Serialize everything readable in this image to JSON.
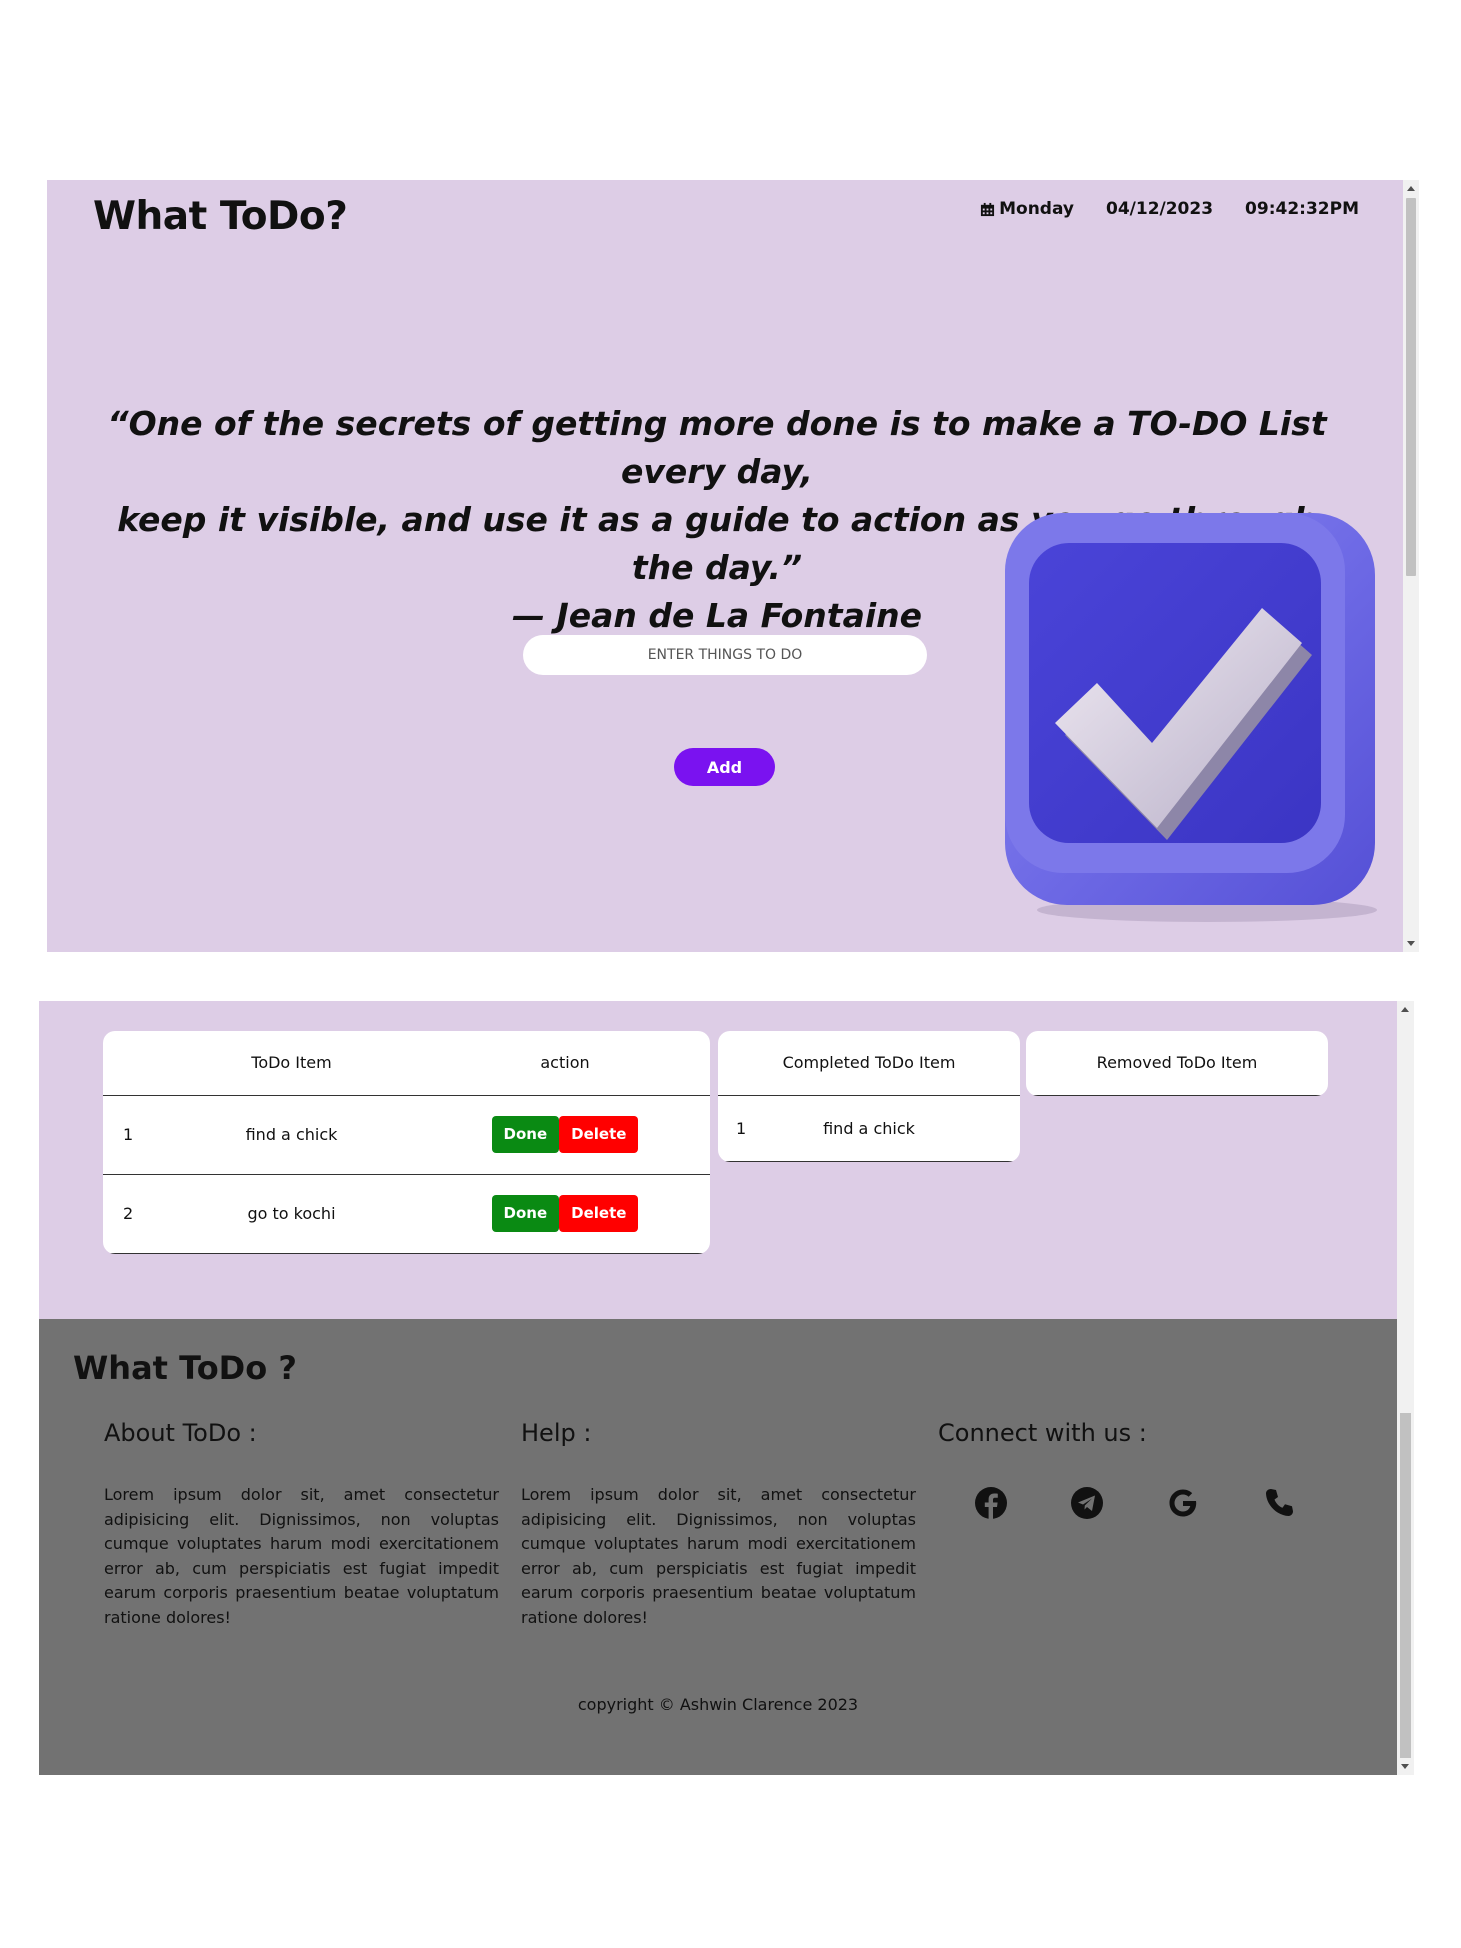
{
  "header": {
    "brand": "What ToDo?",
    "day": "Monday",
    "date": "04/12/2023",
    "time": "09:42:32PM"
  },
  "quote": {
    "line1": "“One of the secrets of getting more done is to make a TO-DO List every day,",
    "line2": "keep it visible, and use it as a guide to action as you go through the day.”",
    "line3": "— Jean de La Fontaine"
  },
  "input": {
    "placeholder": "ENTER THINGS TO DO",
    "value": ""
  },
  "add_button": "Add",
  "todo_table": {
    "headers": [
      "ToDo Item",
      "action"
    ],
    "rows": [
      {
        "num": "1",
        "item": "find a chick"
      },
      {
        "num": "2",
        "item": "go to kochi"
      }
    ],
    "done_label": "Done",
    "delete_label": "Delete"
  },
  "completed_table": {
    "header": "Completed ToDo Item",
    "rows": [
      {
        "num": "1",
        "item": "find a chick"
      }
    ]
  },
  "removed_table": {
    "header": "Removed ToDo Item"
  },
  "footer": {
    "brand": "What ToDo ?",
    "about_title": "About ToDo :",
    "about_text": "Lorem ipsum dolor sit, amet consectetur adipisicing elit. Dignissimos, non voluptas cumque voluptates harum modi exercitationem error ab, cum perspiciatis est fugiat impedit earum corporis praesentium beatae voluptatum ratione dolores!",
    "help_title": "Help :",
    "help_text": "Lorem ipsum dolor sit, amet consectetur adipisicing elit. Dignissimos, non voluptas cumque voluptates harum modi exercitationem error ab, cum perspiciatis est fugiat impedit earum corporis praesentium beatae voluptatum ratione dolores!",
    "connect_title": "Connect with us :",
    "copyright": "copyright © Ashwin Clarence 2023"
  },
  "icons": [
    "calendar-icon",
    "facebook-icon",
    "telegram-icon",
    "google-icon",
    "phone-icon"
  ],
  "colors": {
    "page_bg": "#ddcde6",
    "add_button": "#7a12f0",
    "done_button": "#0a8a13",
    "delete_button": "#ff0000",
    "footer_bg": "#727272"
  }
}
